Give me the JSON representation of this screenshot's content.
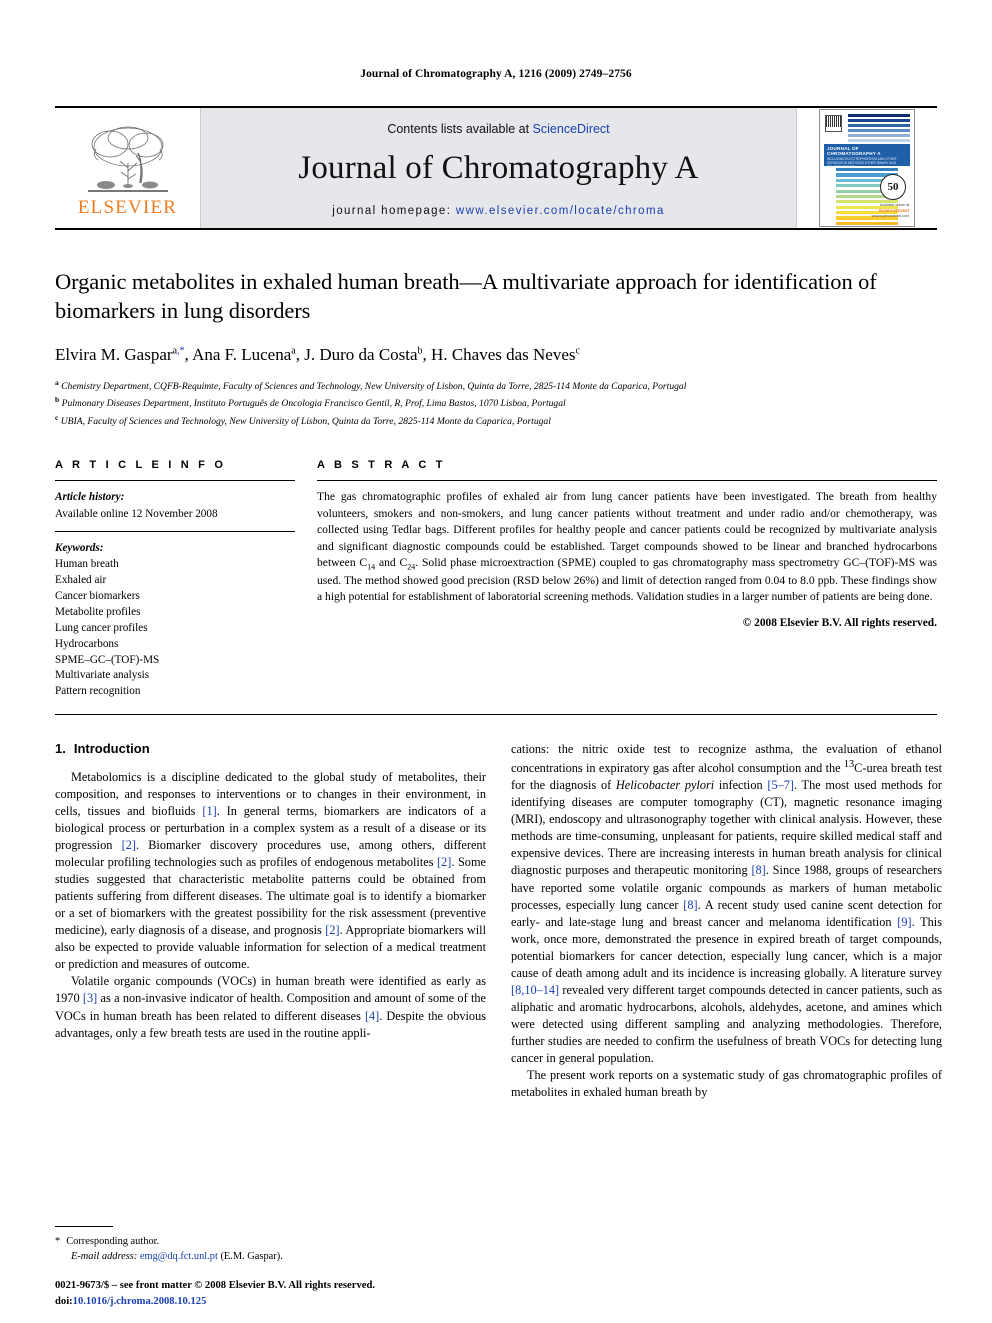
{
  "running_head": "Journal of Chromatography A, 1216 (2009) 2749–2756",
  "masthead": {
    "publisher_name": "ELSEVIER",
    "contents_prefix": "Contents lists available at ",
    "contents_link": "ScienceDirect",
    "journal_name": "Journal of Chromatography A",
    "homepage_prefix": "journal homepage: ",
    "homepage_url": "www.elsevier.com/locate/chroma",
    "cover": {
      "title_line": "JOURNAL OF CHROMATOGRAPHY A",
      "subtitle_line": "INCLUDING ELECTROPHORESIS AND OTHER SEPARATION METHODS OTHER BINARY AND RELATED TOPICS",
      "badge": "50",
      "badge_sub": "YEARS",
      "sciencedirect_label": "Available online at",
      "sciencedirect_brand": "ScienceDirect",
      "sciencedirect_sub": "www.sciencedirect.com"
    }
  },
  "article": {
    "title": "Organic metabolites in exhaled human breath—A multivariate approach for identification of biomarkers in lung disorders",
    "authors": [
      {
        "name": "Elvira M. Gaspar",
        "sup": "a",
        "star": true
      },
      {
        "name": "Ana F. Lucena",
        "sup": "a",
        "star": false
      },
      {
        "name": "J. Duro da Costa",
        "sup": "b",
        "star": false
      },
      {
        "name": "H. Chaves das Neves",
        "sup": "c",
        "star": false
      }
    ],
    "affiliations": [
      {
        "marker": "a",
        "text": "Chemistry Department, CQFB-Requimte, Faculty of Sciences and Technology, New University of Lisbon, Quinta da Torre, 2825-114 Monte da Caparica, Portugal"
      },
      {
        "marker": "b",
        "text": "Pulmonary Diseases Department, Instituto Português de Oncologia Francisco Gentil, R, Prof, Lima Bastos, 1070 Lisboa, Portugal"
      },
      {
        "marker": "c",
        "text": "UBIA, Faculty of Sciences and Technology, New University of Lisbon, Quinta da Torre, 2825-114 Monte da Caparica, Portugal"
      }
    ]
  },
  "article_info": {
    "heading": "A R T I C L E    I N F O",
    "history_label": "Article history:",
    "history_value": "Available online 12 November 2008",
    "keywords_label": "Keywords:",
    "keywords": [
      "Human breath",
      "Exhaled air",
      "Cancer biomarkers",
      "Metabolite profiles",
      "Lung cancer profiles",
      "Hydrocarbons",
      "SPME–GC–(TOF)-MS",
      "Multivariate analysis",
      "Pattern recognition"
    ]
  },
  "abstract": {
    "heading": "A B S T R A C T",
    "text_part1": "The gas chromatographic profiles of exhaled air from lung cancer patients have been investigated. The breath from healthy volunteers, smokers and non-smokers, and lung cancer patients without treatment and under radio and/or chemotherapy, was collected using Tedlar bags. Different profiles for healthy people and cancer patients could be recognized by multivariate analysis and significant diagnostic compounds could be established. Target compounds showed to be linear and branched hydrocarbons between C",
    "sub1": "14",
    "text_part2": " and C",
    "sub2": "24",
    "text_part3": ". Solid phase microextraction (SPME) coupled to gas chromatography mass spectrometry GC–(TOF)-MS was used. The method showed good precision (RSD below 26%) and limit of detection ranged from 0.04 to 8.0 ppb. These findings show a high potential for establishment of laboratorial screening methods. Validation studies in a larger number of patients are being done.",
    "copyright": "© 2008 Elsevier B.V. All rights reserved."
  },
  "section": {
    "number": "1.",
    "title": "Introduction"
  },
  "left_column": {
    "p1_a": "Metabolomics is a discipline dedicated to the global study of metabolites, their composition, and responses to interventions or to changes in their environment, in cells, tissues and biofluids ",
    "p1_r1": "[1]",
    "p1_b": ". In general terms, biomarkers are indicators of a biological process or perturbation in a complex system as a result of a disease or its progression ",
    "p1_r2": "[2]",
    "p1_c": ". Biomarker discovery procedures use, among others, different molecular profiling technologies such as profiles of endogenous metabolites ",
    "p1_r3": "[2]",
    "p1_d": ". Some studies suggested that characteristic metabolite patterns could be obtained from patients suffering from different diseases. The ultimate goal is to identify a biomarker or a set of biomarkers with the greatest possibility for the risk assessment (preventive medicine), early diagnosis of a disease, and prognosis ",
    "p1_r4": "[2]",
    "p1_e": ". Appropriate biomarkers will also be expected to provide valuable information for selection of a medical treatment or prediction and measures of outcome.",
    "p2_a": "Volatile organic compounds (VOCs) in human breath were identified as early as 1970 ",
    "p2_r1": "[3]",
    "p2_b": " as a non-invasive indicator of health. Composition and amount of some of the VOCs in human breath has been related to different diseases ",
    "p2_r2": "[4]",
    "p2_c": ". Despite the obvious advantages, only a few breath tests are used in the routine appli-"
  },
  "right_column": {
    "p1_a": "cations: the nitric oxide test to recognize asthma, the evaluation of ethanol concentrations in expiratory gas after alcohol consumption and the ",
    "p1_sup": "13",
    "p1_b": "C-urea breath test for the diagnosis of ",
    "p1_ital1": "Helicobacter pylori",
    "p1_c": " infection ",
    "p1_r1": "[5–7]",
    "p1_d": ". The most used methods for identifying diseases are computer tomography (CT), magnetic resonance imaging (MRI), endoscopy and ultrasonography together with clinical analysis. However, these methods are time-consuming, unpleasant for patients, require skilled medical staff and expensive devices. There are increasing interests in human breath analysis for clinical diagnostic purposes and therapeutic monitoring ",
    "p1_r2": "[8]",
    "p1_e": ". Since 1988, groups of researchers have reported some volatile organic compounds as markers of human metabolic processes, especially lung cancer ",
    "p1_r3": "[8]",
    "p1_f": ". A recent study used canine scent detection for early- and late-stage lung and breast cancer and melanoma identification ",
    "p1_r4": "[9]",
    "p1_g": ". This work, once more, demonstrated the presence in expired breath of target compounds, potential biomarkers for cancer detection, especially lung cancer, which is a major cause of death among adult and its incidence is increasing globally. A literature survey ",
    "p1_r5": "[8,10–14]",
    "p1_h": " revealed very different target compounds detected in cancer patients, such as aliphatic and aromatic hydrocarbons, alcohols, aldehydes, acetone, and amines which were detected using different sampling and analyzing methodologies. Therefore, further studies are needed to confirm the usefulness of breath VOCs for detecting lung cancer in general population.",
    "p2": "The present work reports on a systematic study of gas chromatographic profiles of metabolites in exhaled human breath by"
  },
  "footnote": {
    "asterisk": "*",
    "corresponding": "Corresponding author.",
    "email_label": "E-mail address:",
    "email": "emg@dq.fct.unl.pt",
    "email_owner": "(E.M. Gaspar)."
  },
  "footer": {
    "issn_line": "0021-9673/$ – see front matter © 2008 Elsevier B.V. All rights reserved.",
    "doi_label": "doi:",
    "doi_value": "10.1016/j.chroma.2008.10.125"
  },
  "colors": {
    "link_blue": "#1a3fae",
    "elsevier_orange": "#f07c21",
    "masthead_grey": "#e6e7ea"
  }
}
